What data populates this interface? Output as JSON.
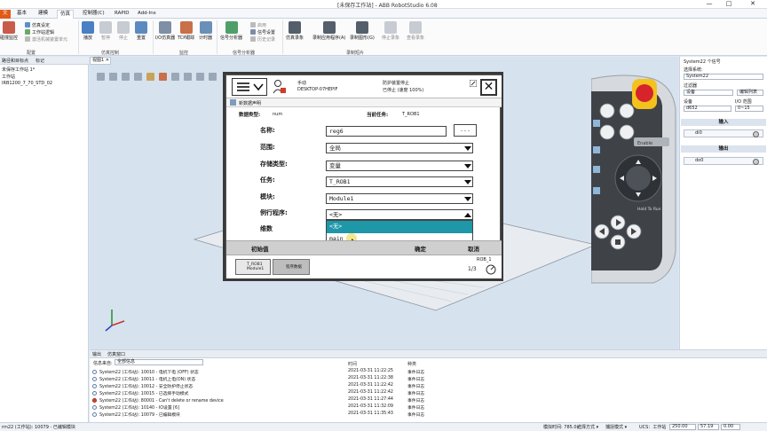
{
  "window": {
    "title": "[未保存工作站] - ABB RobotStudio 6.08",
    "minimize": "—",
    "maximize": "□",
    "close": "✕"
  },
  "menu": {
    "file": "文",
    "tabs": [
      "基本",
      "建模",
      "仿真",
      "控制器(C)",
      "RAPID",
      "Add-Ins"
    ]
  },
  "ribbon": {
    "g1_small": [
      "仿真设定",
      "工作站逻辑",
      "激活机械装置单元"
    ],
    "g1_big": "碰撞监控",
    "play": "播放",
    "pause": "暂停",
    "stop": "停止",
    "reset": "重置",
    "io_sim": "I/O仿真器",
    "tcp": "TCP跟踪",
    "timer": "计时器",
    "sig_analyzer": "信号分析器",
    "sig_small": [
      "启用",
      "信号设置",
      "历史记录"
    ],
    "sim_record": "仿真录象",
    "record_app": "录制应用程序(A)",
    "record_graphic": "录制图形(G)",
    "stop_record": "停止录象",
    "view_record": "查看录象",
    "groups": [
      "配置",
      "仿真控制",
      "监控",
      "信号分析器",
      "录制短片"
    ]
  },
  "left": {
    "tabs": [
      "路径和目标点",
      "标记"
    ],
    "tree": [
      "未保存工作站 1*",
      "工作站",
      "IRB1200_7_70_STD_02"
    ]
  },
  "viewport": {
    "tab": "视图1 ✕"
  },
  "tp": {
    "status_mode": "手动",
    "status_ctrl": "DESKTOP-07HEPIF",
    "status_guard": "防护装置停止",
    "status_stop": "已停止 (速度 100%)",
    "header": "新数据声明",
    "type_label": "数据类型:",
    "type_value": "num",
    "task_label": "当前任务:",
    "task_value": "T_ROB1",
    "name_label": "名称:",
    "name_value": "reg6",
    "dots": "...",
    "scope_label": "范围:",
    "scope_value": "全局",
    "storage_label": "存储类型:",
    "storage_value": "变量",
    "task2_label": "任务:",
    "task2_value": "T_ROB1",
    "module_label": "模块:",
    "module_value": "Module1",
    "routine_label": "例行程序:",
    "routine_value": "<无>",
    "dim_label": "维数",
    "dd_options": [
      "<无>",
      "main"
    ],
    "btn_init": "初始值",
    "btn_ok": "确定",
    "btn_cancel": "取消",
    "task_item1": "T_ROB1\nModule1",
    "task_item2": "程序数据",
    "rob_label": "ROB_1",
    "rob_frac": "1/3"
  },
  "pendant": {
    "enable": "Enable",
    "hold": "Hold To Run"
  },
  "right": {
    "title": "System22 个信号",
    "sys_label": "选择系统:",
    "sys_value": "System22",
    "filter_label": "过滤器",
    "filter_value": "设备",
    "edit_list": "编辑列表",
    "device_label": "设备",
    "io_range_label": "I/O 范围",
    "device_value": "d652",
    "io_range_value": "0~15",
    "input_band": "输入",
    "output_band": "输出",
    "di0": "di0",
    "do0": "do0"
  },
  "output": {
    "tabs": [
      "输出",
      "仿真窗口"
    ],
    "filter_label": "信息来自:",
    "filter_value": "全部信息",
    "col_time": "时间",
    "col_cat": "种类",
    "rows": [
      {
        "msg": "System22 (工作站): 10010 - 电机下电 (OFF) 状态",
        "time": "2021-03-31 11:22:25",
        "cat": "事件日志",
        "err": false
      },
      {
        "msg": "System22 (工作站): 10011 - 电机上电(ON) 状态",
        "time": "2021-03-31 11:22:38",
        "cat": "事件日志",
        "err": false
      },
      {
        "msg": "System22 (工作站): 10012 - 安全防护停止状态",
        "time": "2021-03-31 11:22:42",
        "cat": "事件日志",
        "err": false
      },
      {
        "msg": "System22 (工作站): 10015 - 已选择手动模式",
        "time": "2021-03-31 11:22:42",
        "cat": "事件日志",
        "err": false
      },
      {
        "msg": "System22 (工作站): 80001 - Can't delete or rename device",
        "time": "2021-03-31 11:27:44",
        "cat": "事件日志",
        "err": true
      },
      {
        "msg": "System22 (工作站): 10140 - IO设置 [6]",
        "time": "2021-03-31 11:32:09",
        "cat": "事件日志",
        "err": false
      },
      {
        "msg": "System22 (工作站): 10079 - 已编辑模块",
        "time": "2021-03-31 11:35:43",
        "cat": "事件日志",
        "err": false
      }
    ]
  },
  "status": {
    "left": "rm22 (工作站): 10079 - 已编辑模块",
    "sim_time": "模拟时间: 785.0s",
    "mode1": "选择方式 ▾",
    "mode2": "捕捉模式 ▾",
    "ucs": "UCS：工作站",
    "x": "250.00",
    "y": "57.19",
    "z": "0.00"
  }
}
